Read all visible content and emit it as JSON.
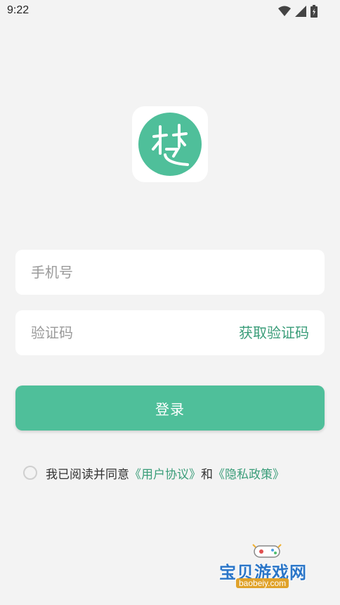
{
  "status_bar": {
    "time": "9:22",
    "icons": [
      "wifi-icon",
      "signal-icon",
      "battery-icon"
    ]
  },
  "logo": {
    "glyph": "楚",
    "color": "#4fbf9a"
  },
  "form": {
    "phone_placeholder": "手机号",
    "code_placeholder": "验证码",
    "get_code_label": "获取验证码"
  },
  "login_button": {
    "label": "登录"
  },
  "agreement": {
    "prefix": "我已阅读并同意",
    "user_agreement": "《用户协议》",
    "conjunction": "和",
    "privacy_policy": "《隐私政策》"
  },
  "watermark": {
    "title": "宝贝游戏网",
    "url": "baobeiy.com"
  },
  "colors": {
    "accent": "#4fbf9a",
    "link": "#3a9d79",
    "background": "#f3f3f3"
  }
}
